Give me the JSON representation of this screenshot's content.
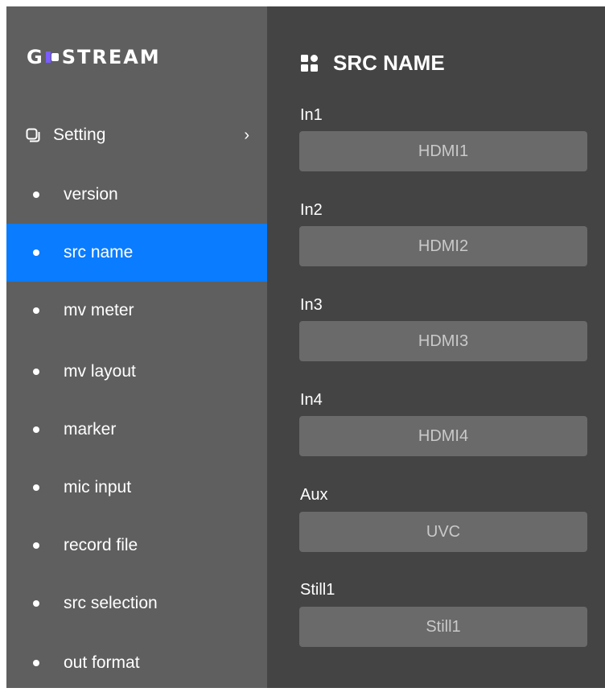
{
  "brand": {
    "logo_text_left": "G",
    "logo_text_right": "STREAM"
  },
  "sidebar": {
    "setting_label": "Setting",
    "items": [
      {
        "label": "version"
      },
      {
        "label": "src name",
        "active": true
      },
      {
        "label": "mv meter"
      },
      {
        "label": "mv layout"
      },
      {
        "label": "marker"
      },
      {
        "label": "mic input"
      },
      {
        "label": "record file"
      },
      {
        "label": "src selection"
      },
      {
        "label": "out format"
      }
    ]
  },
  "panel": {
    "title": "SRC NAME",
    "fields": [
      {
        "label": "In1",
        "value": "HDMI1"
      },
      {
        "label": "In2",
        "value": "HDMI2"
      },
      {
        "label": "In3",
        "value": "HDMI3"
      },
      {
        "label": "In4",
        "value": "HDMI4"
      },
      {
        "label": "Aux",
        "value": "UVC"
      },
      {
        "label": "Still1",
        "value": "Still1"
      }
    ]
  },
  "colors": {
    "sidebar_bg": "#5f5f5f",
    "main_bg": "#444444",
    "active_item": "#0a7cff",
    "input_bg": "#6a6a6a"
  }
}
